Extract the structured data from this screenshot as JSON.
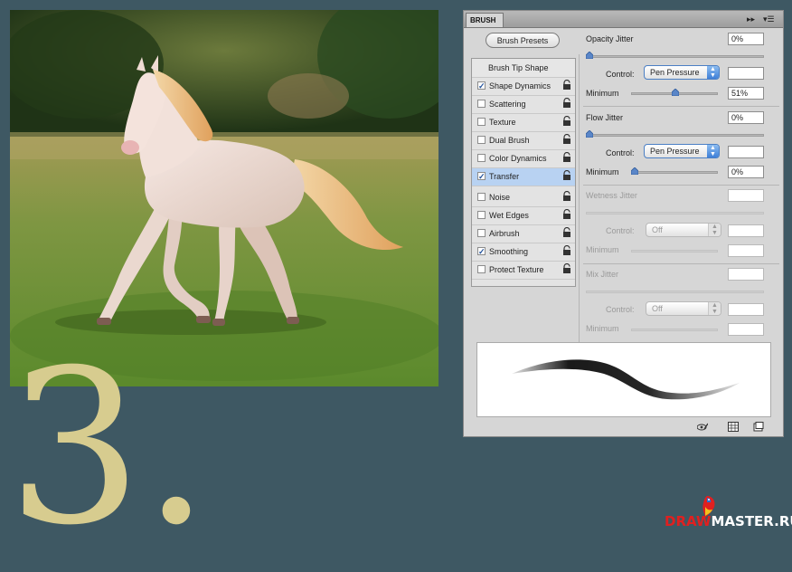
{
  "step_number": "3.",
  "watermark": {
    "part1": "DRAW",
    "part2": "MASTER.RU"
  },
  "panel": {
    "tab_title": "BRUSH",
    "icons": {
      "collapse": "double-arrow-icon",
      "menu": "panel-menu-icon"
    },
    "presets_button": "Brush Presets",
    "options": [
      {
        "label": "Brush Tip Shape",
        "header": true
      },
      {
        "label": "Shape Dynamics",
        "checked": true,
        "lock": true
      },
      {
        "label": "Scattering",
        "checked": false,
        "lock": true
      },
      {
        "label": "Texture",
        "checked": false,
        "lock": true
      },
      {
        "label": "Dual Brush",
        "checked": false,
        "lock": true
      },
      {
        "label": "Color Dynamics",
        "checked": false,
        "lock": true
      },
      {
        "label": "Transfer",
        "checked": true,
        "lock": true,
        "selected": true
      },
      {
        "label": "Noise",
        "checked": false,
        "lock": true
      },
      {
        "label": "Wet Edges",
        "checked": false,
        "lock": true
      },
      {
        "label": "Airbrush",
        "checked": false,
        "lock": true
      },
      {
        "label": "Smoothing",
        "checked": true,
        "lock": true
      },
      {
        "label": "Protect Texture",
        "checked": false,
        "lock": true
      }
    ],
    "opacity_jitter": {
      "label": "Opacity Jitter",
      "value": "0%",
      "slider": 0.0
    },
    "opacity_control": {
      "label": "Control:",
      "value": "Pen Pressure"
    },
    "opacity_minimum": {
      "label": "Minimum",
      "value": "51%",
      "slider": 0.51
    },
    "flow_jitter": {
      "label": "Flow Jitter",
      "value": "0%",
      "slider": 0.0
    },
    "flow_control": {
      "label": "Control:",
      "value": "Pen Pressure"
    },
    "flow_minimum": {
      "label": "Minimum",
      "value": "0%",
      "slider": 0.0
    },
    "wetness_jitter": {
      "label": "Wetness Jitter",
      "value": ""
    },
    "wetness_control": {
      "label": "Control:",
      "value": "Off"
    },
    "wetness_minimum": {
      "label": "Minimum",
      "value": ""
    },
    "mix_jitter": {
      "label": "Mix Jitter",
      "value": ""
    },
    "mix_control": {
      "label": "Control:",
      "value": "Off"
    },
    "mix_minimum": {
      "label": "Minimum",
      "value": ""
    },
    "bottom_icons": [
      "eye-brush-icon",
      "grid-icon",
      "new-preset-icon"
    ]
  },
  "colors": {
    "background": "#3e5863",
    "number": "#d7cc8f",
    "selection": "#b8d2f2",
    "accent": "#3f80d8"
  }
}
